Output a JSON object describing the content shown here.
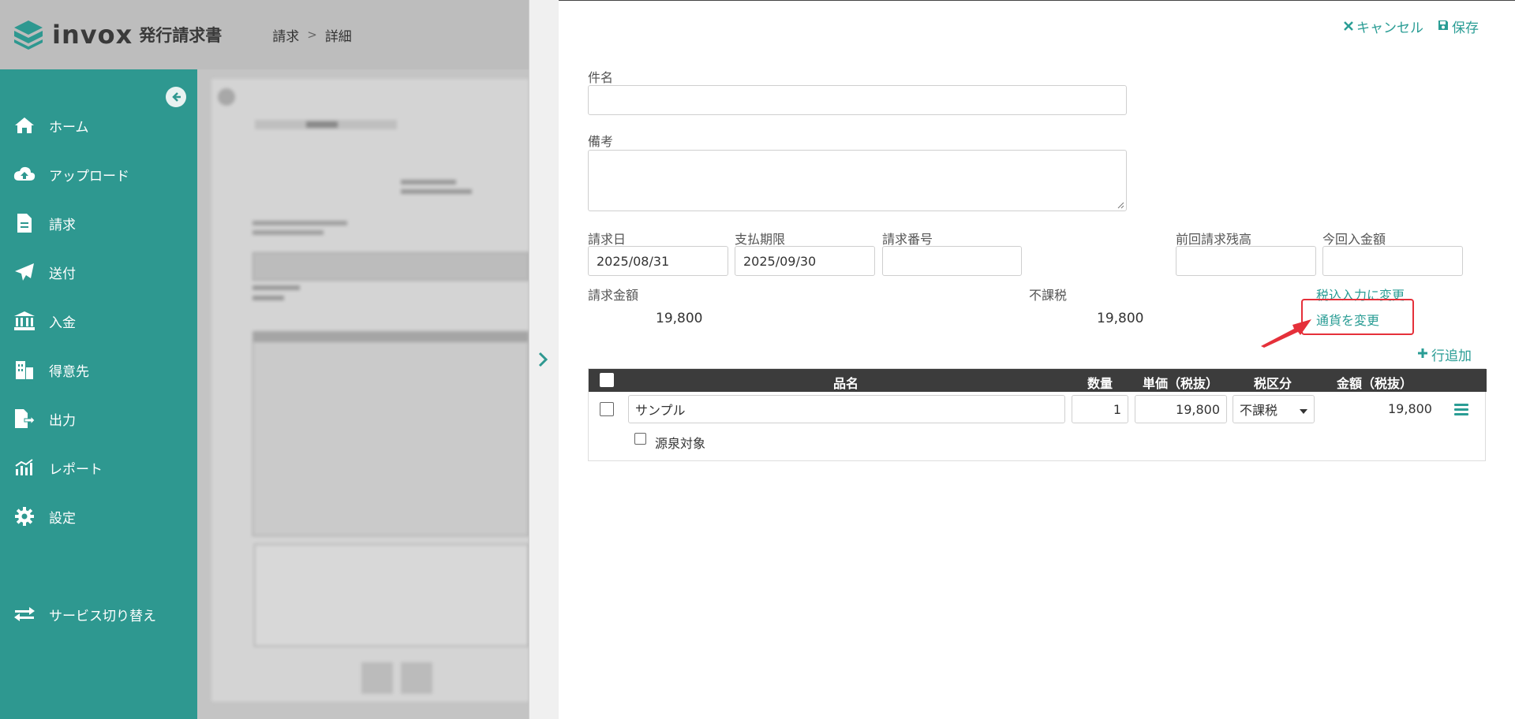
{
  "header": {
    "logo_text": "invox",
    "logo_sub": "発行請求書",
    "breadcrumb": [
      "請求",
      "詳細"
    ],
    "breadcrumb_sep": ">"
  },
  "sidebar": {
    "items": [
      {
        "label": "ホーム",
        "icon": "home-icon"
      },
      {
        "label": "アップロード",
        "icon": "cloud-upload-icon"
      },
      {
        "label": "請求",
        "icon": "document-icon"
      },
      {
        "label": "送付",
        "icon": "paper-plane-icon"
      },
      {
        "label": "入金",
        "icon": "bank-icon"
      },
      {
        "label": "得意先",
        "icon": "building-icon"
      },
      {
        "label": "出力",
        "icon": "file-export-icon"
      },
      {
        "label": "レポート",
        "icon": "chart-icon"
      },
      {
        "label": "設定",
        "icon": "gear-icon"
      }
    ],
    "service_switch": "サービス切り替え"
  },
  "actions": {
    "cancel": "キャンセル",
    "save": "保存"
  },
  "form": {
    "subject_label": "件名",
    "subject_value": "",
    "note_label": "備考",
    "note_value": "",
    "invoice_date_label": "請求日",
    "invoice_date_value": "2025/08/31",
    "due_date_label": "支払期限",
    "due_date_value": "2025/09/30",
    "invoice_number_label": "請求番号",
    "invoice_number_value": "",
    "prev_balance_label": "前回請求残高",
    "prev_balance_value": "",
    "current_payment_label": "今回入金額",
    "current_payment_value": "",
    "amount_label": "請求金額",
    "amount_value": "19,800",
    "tax_label": "不課税",
    "tax_value": "19,800",
    "tax_inclusive_link": "税込入力に変更",
    "currency_link": "通貨を変更",
    "add_row": "行追加"
  },
  "table": {
    "headers": {
      "item": "品名",
      "qty": "数量",
      "unit_price": "単価（税抜）",
      "tax_class": "税区分",
      "amount": "金額（税抜）"
    },
    "rows": [
      {
        "item": "サンプル",
        "qty": "1",
        "unit_price": "19,800",
        "tax_class": "不課税",
        "amount": "19,800",
        "withholding_label": "源泉対象"
      }
    ]
  },
  "colors": {
    "brand": "#2e9890",
    "link": "#2a9d95",
    "highlight": "#e5303a"
  }
}
